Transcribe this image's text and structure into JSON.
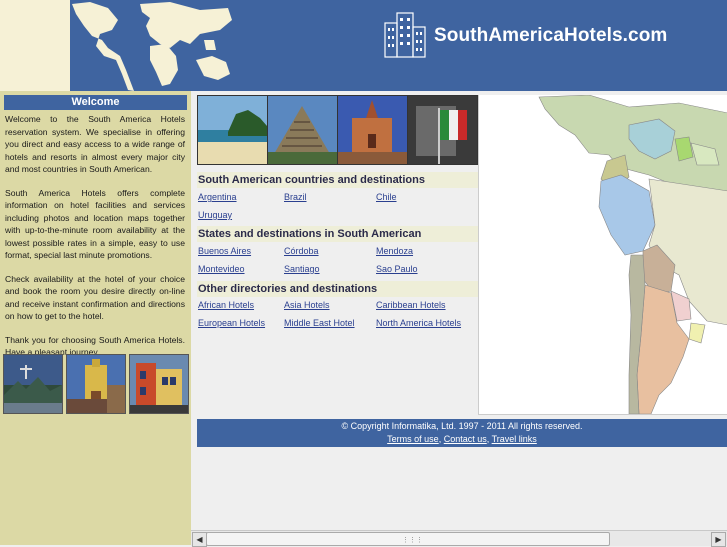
{
  "header": {
    "logo_text": "SouthAmericaHotels.com"
  },
  "sidebar": {
    "welcome_title": "Welcome",
    "paragraphs": [
      "Welcome to the South America Hotels reservation system. We specialise in offering you direct and easy access to a wide range of hotels and resorts in almost every major city and most countries in South American.",
      "South America Hotels offers complete information on hotel facilities and services including photos and location maps together with up-to-the-minute room availability at the lowest possible rates in a simple, easy to use format, special last minute promotions.",
      "Check availability at the hotel of your choice and book the room you desire directly on-line and receive instant confirmation and directions on how to get to the hotel.",
      "Thank you for choosing South America Hotels. Have a pleasant journey."
    ]
  },
  "sections": {
    "countries_title": "South American countries and destinations",
    "countries": [
      "Argentina",
      "Brazil",
      "Chile",
      "Uruguay"
    ],
    "states_title": "States and destinations in South American",
    "states": [
      "Buenos Aires",
      "Córdoba",
      "Mendoza",
      "Montevideo",
      "Santiago",
      "Sao Paulo"
    ],
    "other_title": "Other directories and destinations",
    "other": [
      "African Hotels",
      "Asia Hotels",
      "Caribbean Hotels",
      "European Hotels",
      "Middle East Hotel",
      "North America Hotels"
    ]
  },
  "footer": {
    "copyright": "© Copyright Informatika, Ltd. 1997 - 2011 All rights reserved.",
    "terms": "Terms of use",
    "contact": "Contact us",
    "travel": "Travel links",
    "sep1": ",",
    "sep2": ","
  },
  "scrollbar": {
    "left_arrow": "◀",
    "right_arrow": "▶",
    "grip": "⋮⋮⋮"
  },
  "colors": {
    "header_blue": "#3f64a0",
    "sidebar_bg": "#dcd9a5",
    "link": "#2a3f8f"
  }
}
